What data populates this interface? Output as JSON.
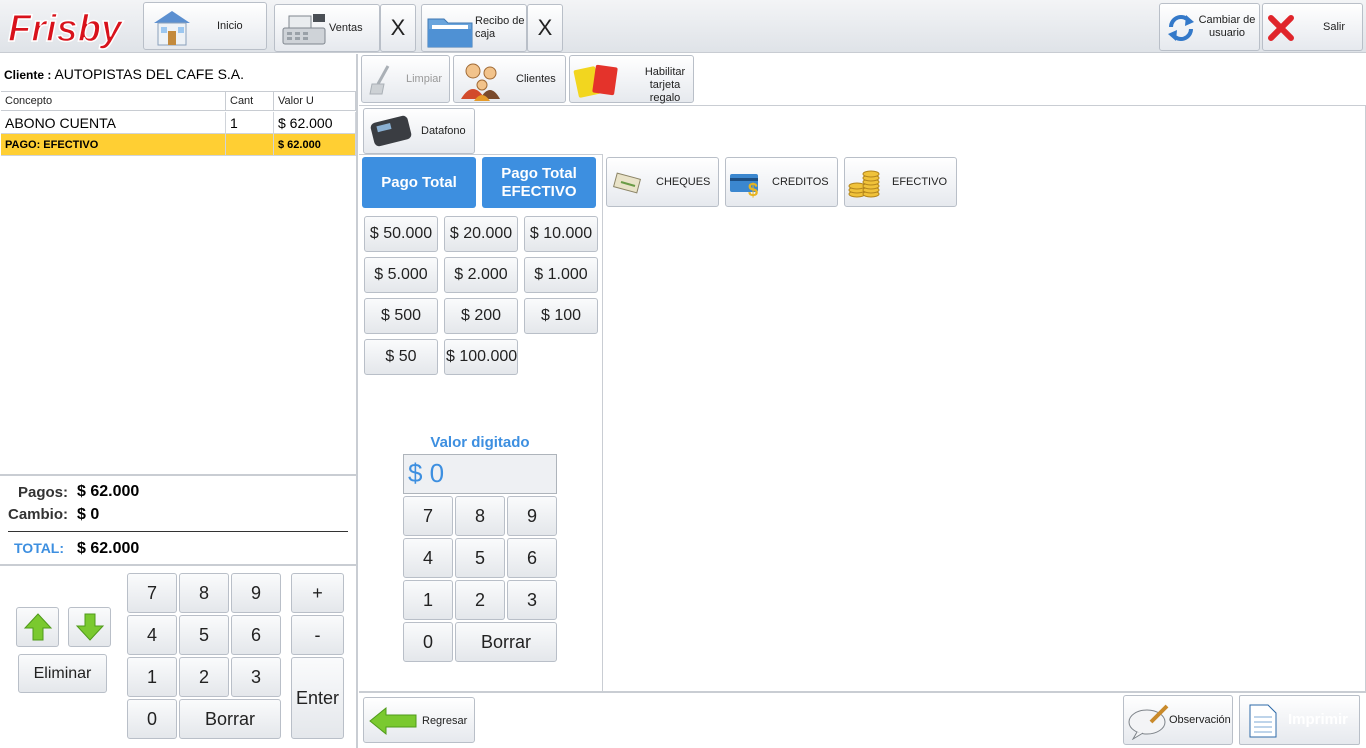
{
  "app": {
    "logo_text": "Frisby"
  },
  "toolbar": {
    "inicio": "Inicio",
    "ventas": "Ventas",
    "ventas_close": "X",
    "recibo": "Recibo de caja",
    "recibo_close": "X",
    "cambiar_usuario": "Cambiar de usuario",
    "salir": "Salir"
  },
  "client": {
    "label": "Cliente :",
    "name": "AUTOPISTAS DEL CAFE S.A."
  },
  "grid": {
    "headers": [
      "Concepto",
      "Cant",
      "Valor U"
    ],
    "rows": [
      {
        "concepto": "ABONO CUENTA",
        "cant": "1",
        "valor": "$ 62.000"
      },
      {
        "concepto": "PAGO: EFECTIVO",
        "cant": "",
        "valor": "$ 62.000"
      }
    ]
  },
  "totals": {
    "pagos_label": "Pagos:",
    "pagos": "$ 62.000",
    "cambio_label": "Cambio:",
    "cambio": "$ 0",
    "total_label": "TOTAL:",
    "total": "$ 62.000"
  },
  "left_keypad": {
    "keys": [
      "7",
      "8",
      "9",
      "4",
      "5",
      "6",
      "1",
      "2",
      "3",
      "0"
    ],
    "borrar": "Borrar",
    "plus": "+",
    "minus": "-",
    "enter": "Enter",
    "eliminar": "Eliminar"
  },
  "actions": {
    "limpiar": "Limpiar",
    "clientes": "Clientes",
    "habilitar": "Habilitar tarjeta regalo",
    "datafono": "Datafono"
  },
  "payment": {
    "pago_total": "Pago Total",
    "pago_total_efectivo": "Pago Total EFECTIVO",
    "amounts": [
      "$ 50.000",
      "$ 20.000",
      "$ 10.000",
      "$ 5.000",
      "$ 2.000",
      "$ 1.000",
      "$ 500",
      "$ 200",
      "$ 100",
      "$ 50",
      "$ 100.000"
    ],
    "methods": [
      "CHEQUES",
      "CREDITOS",
      "EFECTIVO"
    ],
    "valor_label": "Valor digitado",
    "valor_value": "$ 0",
    "borrar": "Borrar"
  },
  "bottom": {
    "regresar": "Regresar",
    "observacion": "Observación",
    "imprimir": "Imprimir"
  },
  "colors": {
    "accent_blue": "#3d8fe0",
    "selected_row": "#ffcf33",
    "brand_red": "#d8121b"
  }
}
